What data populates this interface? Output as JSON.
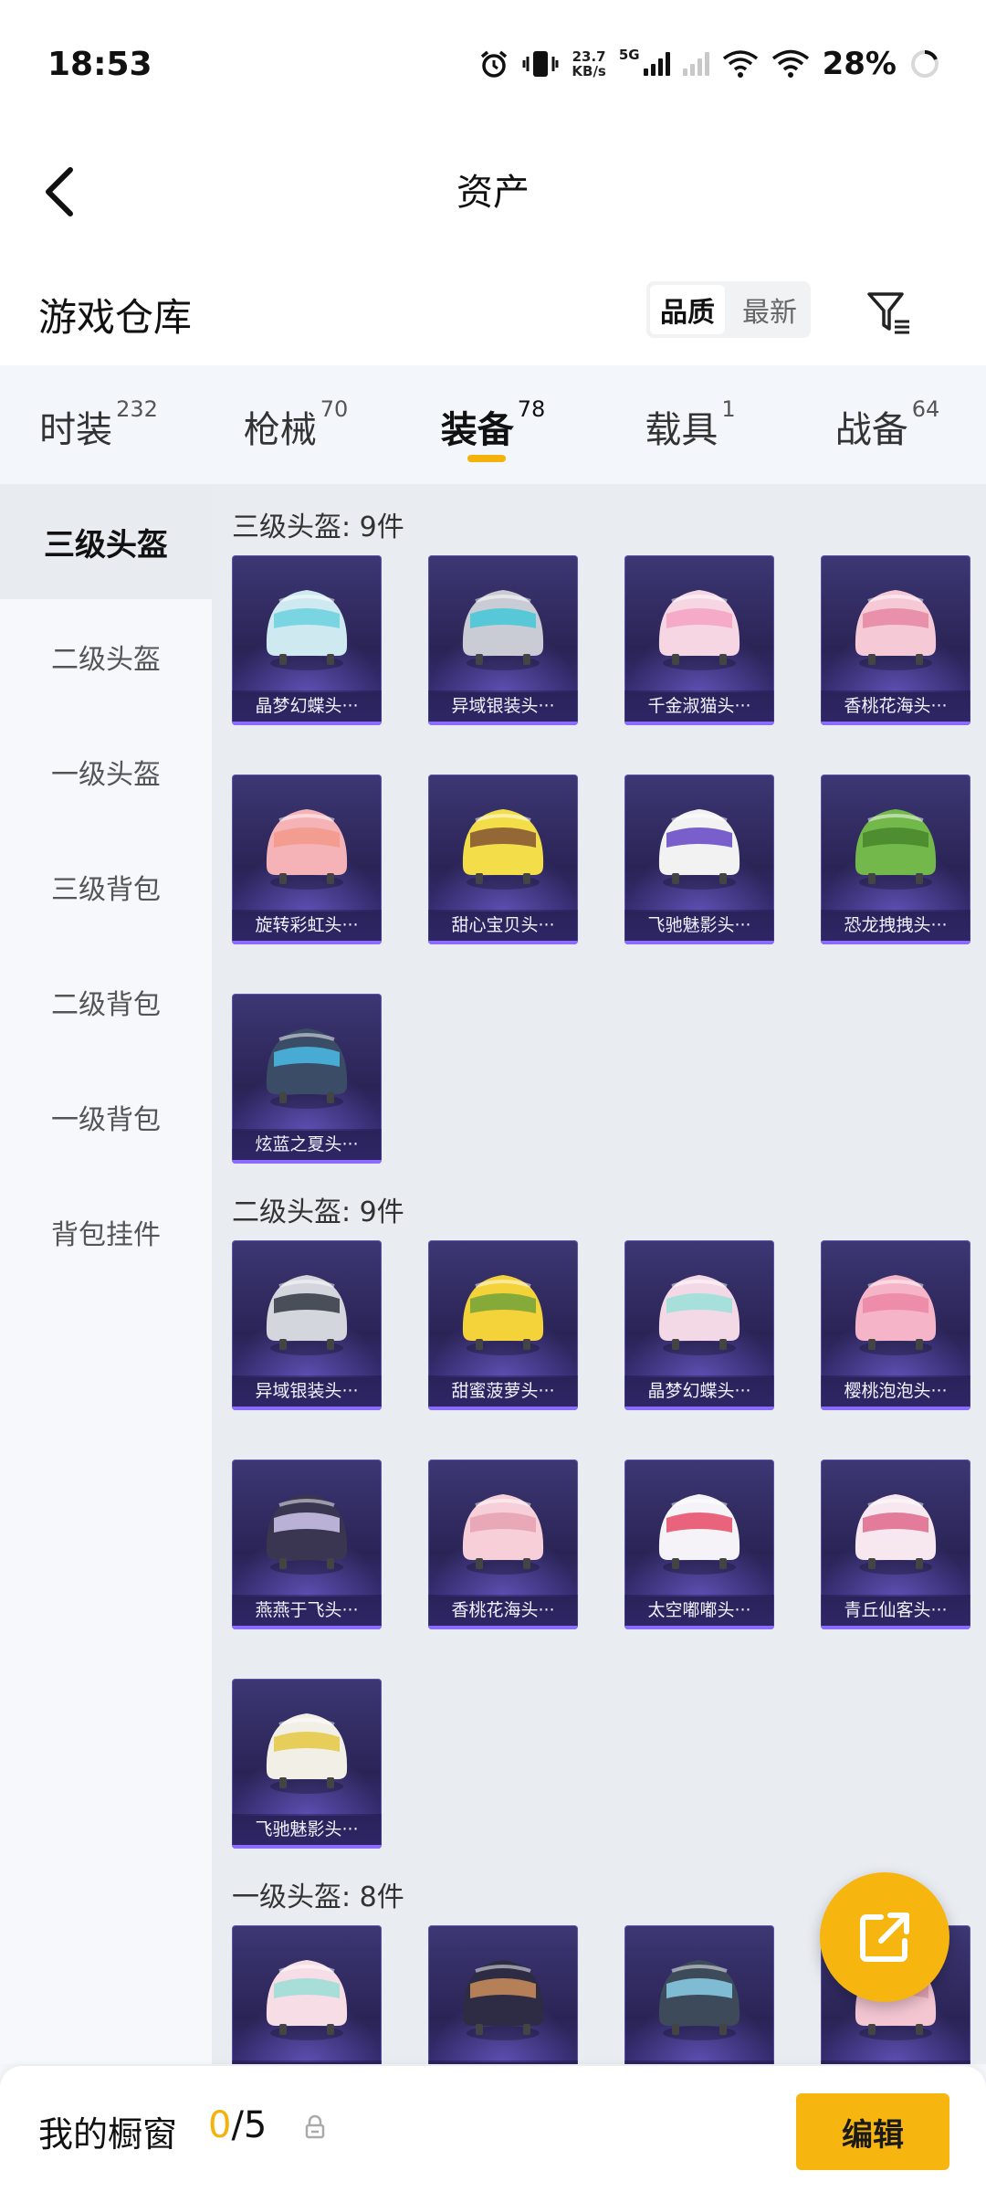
{
  "status_bar": {
    "time": "18:53",
    "net_speed_value": "23.7",
    "net_speed_unit": "KB/s",
    "network_type": "5G",
    "battery": "28%"
  },
  "header": {
    "title": "资产"
  },
  "warehouse": {
    "title": "游戏仓库",
    "sort_options": [
      "品质",
      "最新"
    ],
    "sort_selected": "品质"
  },
  "tabs": [
    {
      "label": "时装",
      "count": "232"
    },
    {
      "label": "枪械",
      "count": "70"
    },
    {
      "label": "装备",
      "count": "78"
    },
    {
      "label": "载具",
      "count": "1"
    },
    {
      "label": "战备",
      "count": "64"
    }
  ],
  "active_tab": "装备",
  "sidebar": {
    "items": [
      "三级头盔",
      "二级头盔",
      "一级头盔",
      "三级背包",
      "二级背包",
      "一级背包",
      "背包挂件"
    ],
    "active": "三级头盔"
  },
  "sections": [
    {
      "title": "三级头盔: 9件",
      "items": [
        {
          "name": "晶梦幻蝶头···",
          "colors": [
            "#cfe9f0",
            "#6fd3e0"
          ]
        },
        {
          "name": "异域银装头···",
          "colors": [
            "#c9ccd4",
            "#49c8d8"
          ]
        },
        {
          "name": "千金淑猫头···",
          "colors": [
            "#f7d6e4",
            "#f4a6c4"
          ]
        },
        {
          "name": "香桃花海头···",
          "colors": [
            "#f6c9d6",
            "#e88aa6"
          ]
        },
        {
          "name": "旋转彩虹头···",
          "colors": [
            "#f5b3b8",
            "#f39a8c"
          ]
        },
        {
          "name": "甜心宝贝头···",
          "colors": [
            "#f3de4a",
            "#8a5a34"
          ]
        },
        {
          "name": "飞驰魅影头···",
          "colors": [
            "#f2f2f2",
            "#6a4fc8"
          ]
        },
        {
          "name": "恐龙拽拽头···",
          "colors": [
            "#73b84b",
            "#4a8a2e"
          ]
        },
        {
          "name": "炫蓝之夏头···",
          "colors": [
            "#3a4c66",
            "#49b6e0"
          ]
        }
      ]
    },
    {
      "title": "二级头盔: 9件",
      "items": [
        {
          "name": "异域银装头···",
          "colors": [
            "#d3d6dc",
            "#3a3f4a"
          ]
        },
        {
          "name": "甜蜜菠萝头···",
          "colors": [
            "#f4d23a",
            "#7aa53a"
          ]
        },
        {
          "name": "晶梦幻蝶头···",
          "colors": [
            "#f3d9e6",
            "#9fe0d8"
          ]
        },
        {
          "name": "樱桃泡泡头···",
          "colors": [
            "#f6b4c8",
            "#ec88a6"
          ]
        },
        {
          "name": "燕燕于飞头···",
          "colors": [
            "#3a3550",
            "#c9bfe6"
          ]
        },
        {
          "name": "香桃花海头···",
          "colors": [
            "#f6cfd8",
            "#e7a3b4"
          ]
        },
        {
          "name": "太空嘟嘟头···",
          "colors": [
            "#f5f3f8",
            "#e8536e"
          ]
        },
        {
          "name": "青丘仙客头···",
          "colors": [
            "#f6e8ee",
            "#e07090"
          ]
        },
        {
          "name": "飞驰魅影头···",
          "colors": [
            "#f2efe6",
            "#e6c94a"
          ]
        }
      ]
    },
    {
      "title": "一级头盔: 8件",
      "items": [
        {
          "name": "",
          "colors": [
            "#f6dde6",
            "#9fded6"
          ]
        },
        {
          "name": "",
          "colors": [
            "#2e2c44",
            "#c48a5a"
          ]
        },
        {
          "name": "",
          "colors": [
            "#3c4a5a",
            "#86c9e0"
          ]
        },
        {
          "name": "",
          "colors": [
            "#f4c6d2",
            "#e8a0b2"
          ]
        }
      ]
    }
  ],
  "showcase": {
    "label": "我的橱窗",
    "current": "0",
    "total": "/5"
  },
  "edit_button": "编辑",
  "accent_color": "#f7b50f"
}
